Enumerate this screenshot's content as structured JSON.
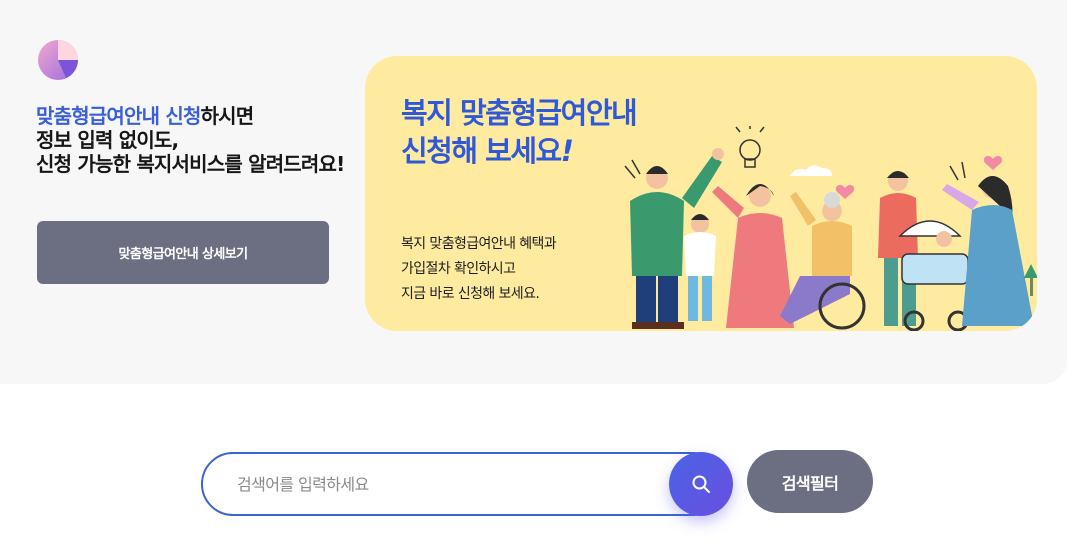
{
  "intro": {
    "highlight": "맞춤형급여안내 신청",
    "line1_rest": "하시면",
    "line2": "정보 입력 없이도,",
    "line3": "신청 가능한 복지서비스를 알려드려요!"
  },
  "detail_button": {
    "label": "맞춤형급여안내 상세보기"
  },
  "banner": {
    "title_line1": "복지 맞춤형급여안내",
    "title_line2": "신청해 보세요",
    "title_exclaim": "!",
    "desc_line1": "복지 맞춤형급여안내 혜택과",
    "desc_line2": "가입절차 확인하시고",
    "desc_line3": "지금 바로 신청해 보세요."
  },
  "search": {
    "placeholder": "검색어를 입력하세요",
    "value": "",
    "icon": "search-icon"
  },
  "filter_button": {
    "label": "검색필터"
  },
  "colors": {
    "accent": "#3a5fd9",
    "banner_bg": "#ffeba0",
    "button_gray": "#6c6f82",
    "search_gradient_start": "#4a63e6",
    "search_gradient_end": "#6a4fe0"
  }
}
